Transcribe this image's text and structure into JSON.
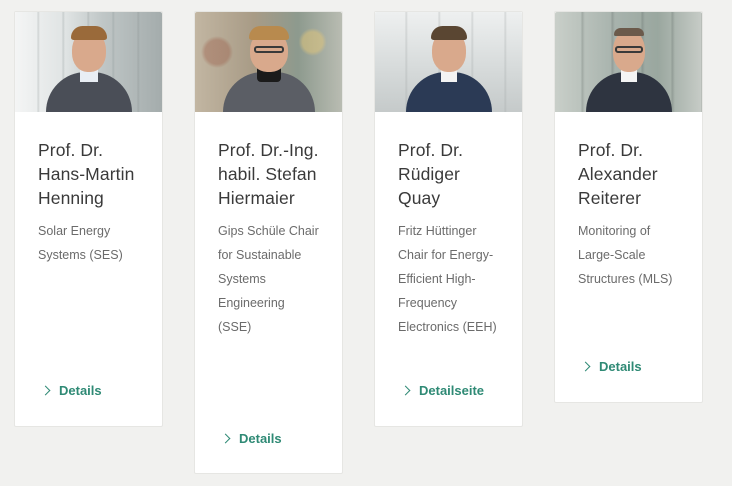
{
  "colors": {
    "page_bg": "#f1f1ef",
    "card_bg": "#ffffff",
    "name_text": "#3a3a3a",
    "desc_text": "#6b6b6b",
    "link": "#2f8a75"
  },
  "cards": [
    {
      "name": "Prof. Dr. Hans-Martin Henning",
      "description": "Solar Energy Systems (SES)",
      "link_label": "Details",
      "link_icon": "chevron-right-icon"
    },
    {
      "name": "Prof. Dr.-Ing. habil. Stefan Hiermaier",
      "description": "Gips Schüle Chair for Sustainable Systems Engineering (SSE)",
      "link_label": "Details",
      "link_icon": "chevron-right-icon"
    },
    {
      "name": "Prof. Dr. Rüdiger Quay",
      "description": "Fritz Hüttinger Chair for Energy-Efficient High-Frequency Electronics (EEH)",
      "link_label": "Detailseite",
      "link_icon": "chevron-right-icon"
    },
    {
      "name": "Prof. Dr. Alexander Reiterer",
      "description": "Monitoring of Large-Scale Structures (MLS)",
      "link_label": "Details",
      "link_icon": "chevron-right-icon"
    }
  ]
}
